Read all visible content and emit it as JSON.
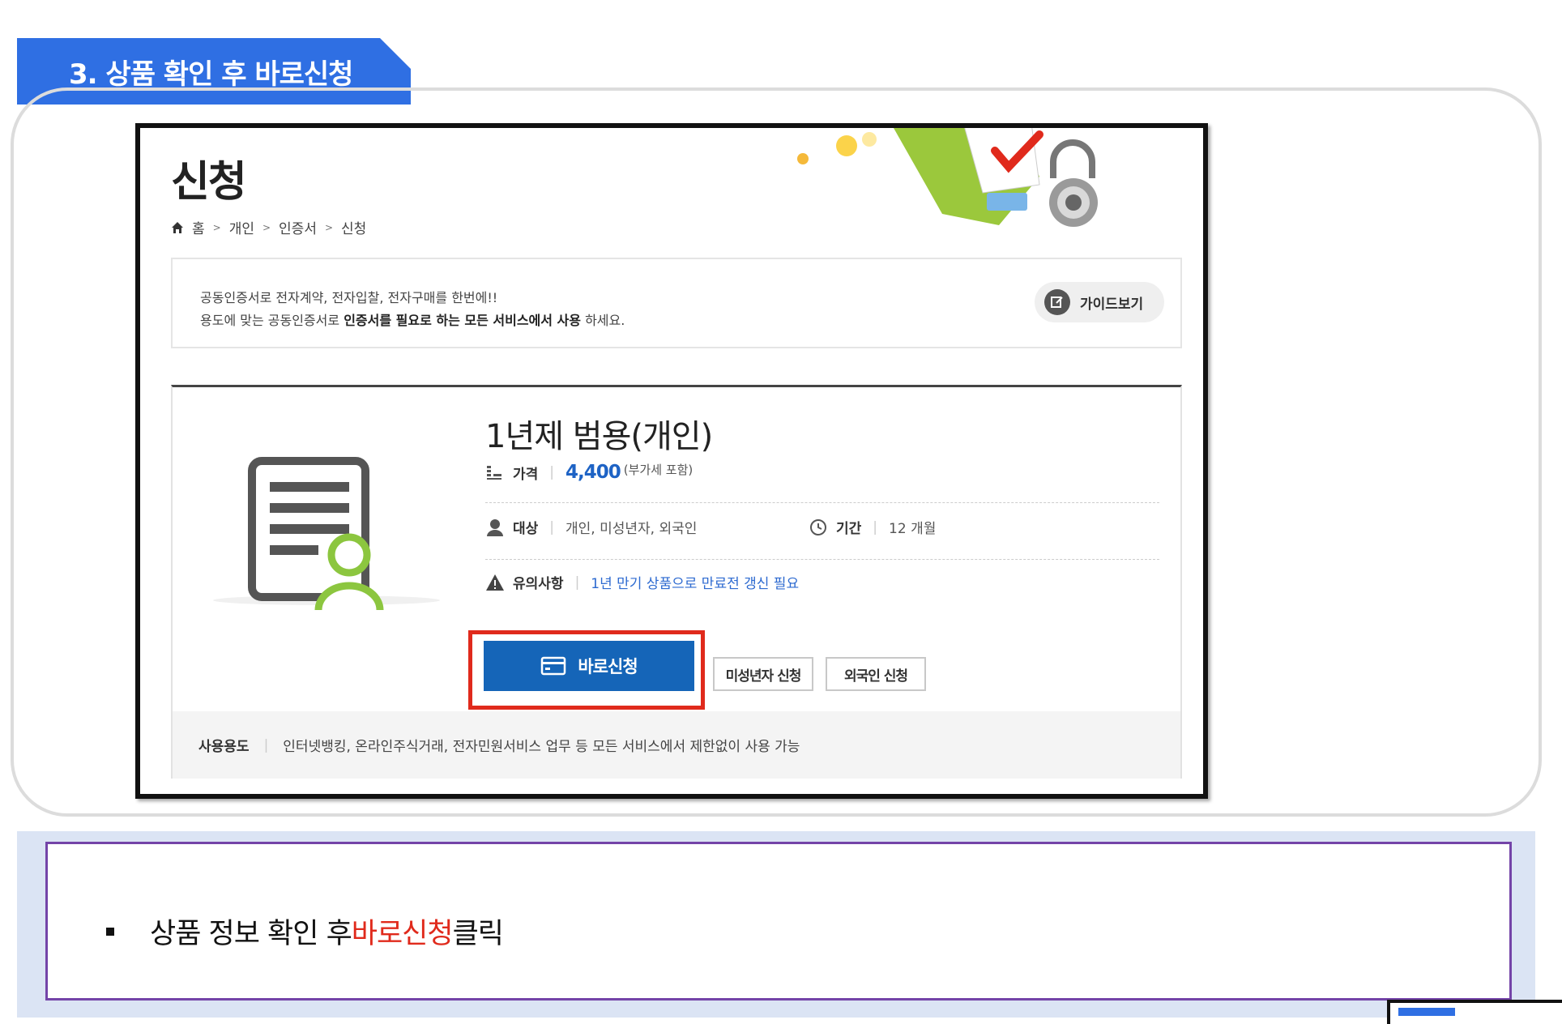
{
  "step": {
    "title": "3. 상품 확인 후 바로신청"
  },
  "page": {
    "title": "신청",
    "breadcrumb": [
      "홈",
      "개인",
      "인증서",
      "신청"
    ]
  },
  "notice": {
    "line1": "공동인증서로 전자계약, 전자입찰, 전자구매를 한번에!!",
    "line2_pre": "용도에 맞는 공동인증서로 ",
    "line2_bold": "인증서를 필요로 하는 모든 서비스에서 사용",
    "line2_post": " 하세요.",
    "guide_button": "가이드보기"
  },
  "product": {
    "name": "1년제 범용(개인)",
    "price_label": "가격",
    "price": "4,400",
    "vat_note": "(부가세 포함)",
    "target_label": "대상",
    "target_value": "개인, 미성년자, 외국인",
    "period_label": "기간",
    "period_value": "12 개월",
    "caution_label": "유의사항",
    "caution_value": "1년 만기 상품으로 만료전 갱신 필요",
    "buy_button": "바로신청",
    "minor_button": "미성년자 신청",
    "foreign_button": "외국인 신청",
    "usage_label": "사용용도",
    "usage_value": "인터넷뱅킹, 온라인주식거래, 전자민원서비스 업무 등 모든 서비스에서 제한없이 사용 가능"
  },
  "instruction": {
    "pre": "상품 정보 확인 후 ",
    "highlight": "바로신청",
    "post": " 클릭"
  },
  "colors": {
    "step_tab": "#2f6fe3",
    "primary_button": "#1565b8",
    "highlight_red": "#e02a1c",
    "price_blue": "#1e63c5",
    "panel_purple": "#7444a8",
    "panel_bg": "#dbe4f4"
  }
}
